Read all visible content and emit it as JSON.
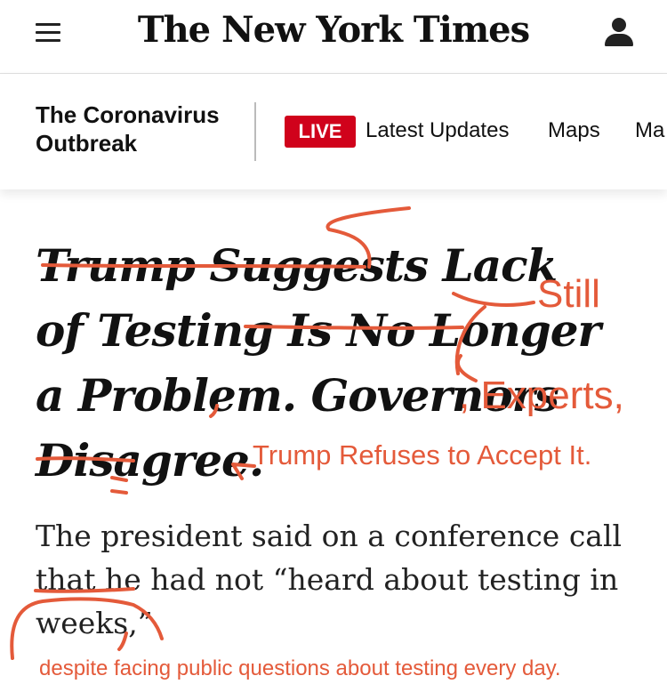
{
  "header": {
    "logo": "The New York Times",
    "menu_icon": "menu-icon",
    "account_icon": "user-icon"
  },
  "subnav": {
    "section_title": "The Coronavirus Outbreak",
    "live_label": "LIVE",
    "links": [
      "Latest Updates",
      "Maps",
      "Ma"
    ]
  },
  "article": {
    "headline": "Trump Suggests Lack of Testing Is No Longer a Problem. Governors Disagree.",
    "summary": "The president said on a conference call that he had not “heard about testing in weeks,”"
  },
  "annotations": {
    "still": "Still",
    "experts": ", Experts,",
    "trump_refuses": "Trump Refuses to Accept It.",
    "despite": "despite facing public questions about testing every day.",
    "ink_color": "#e45a3a"
  },
  "colors": {
    "live_red": "#d0021b",
    "text": "#111111"
  }
}
